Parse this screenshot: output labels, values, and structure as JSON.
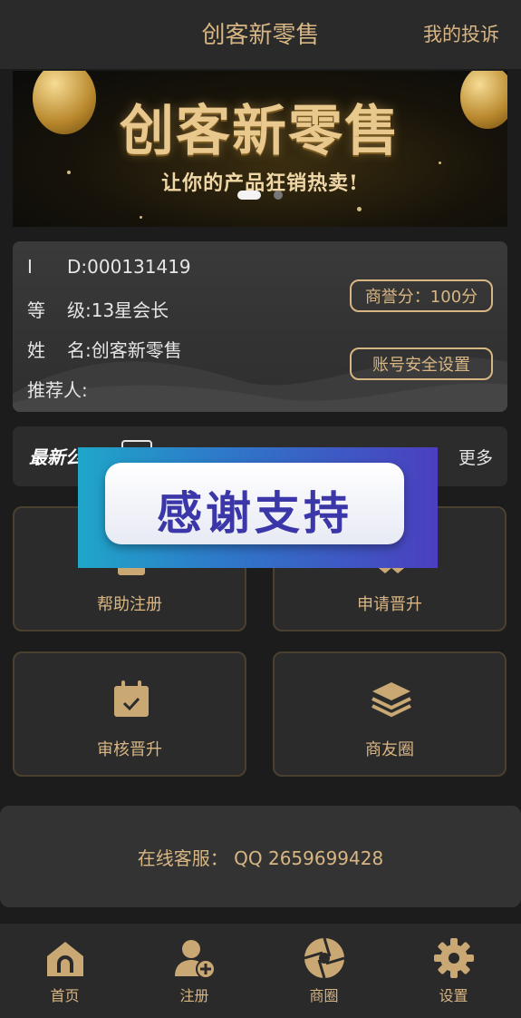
{
  "header": {
    "title": "创客新零售",
    "complaint_link": "我的投诉"
  },
  "banner": {
    "headline": "创客新零售",
    "slogan": "让你的产品狂销热卖!",
    "active_slide": 1,
    "slide_count": 2
  },
  "profile": {
    "id_key": "I",
    "id_value": "D:000131419",
    "level_key": "等",
    "level_value": "级:13星会长",
    "name_key": "姓",
    "name_value": "名:创客新零售",
    "referrer_key": "推荐人:",
    "referrer_value": "",
    "reputation_button": "商誉分：100分",
    "security_button": "账号安全设置"
  },
  "notice": {
    "label": "最新公告",
    "more": "更多"
  },
  "tiles": [
    {
      "label": "帮助注册",
      "icon": "register-help-icon"
    },
    {
      "label": "申请晋升",
      "icon": "apply-upgrade-icon"
    },
    {
      "label": "审核晋升",
      "icon": "calendar-check-icon"
    },
    {
      "label": "商友圈",
      "icon": "layers-icon"
    }
  ],
  "overlay": {
    "text": "感谢支持"
  },
  "service": {
    "text": "在线客服：  QQ 2659699428"
  },
  "tabbar": [
    {
      "label": "首页",
      "icon": "home-icon"
    },
    {
      "label": "注册",
      "icon": "user-add-icon"
    },
    {
      "label": "商圈",
      "icon": "aperture-icon"
    },
    {
      "label": "设置",
      "icon": "gear-icon"
    }
  ],
  "colors": {
    "gold": "#d8b684",
    "background": "#1c1c1c",
    "card": "#333333"
  }
}
